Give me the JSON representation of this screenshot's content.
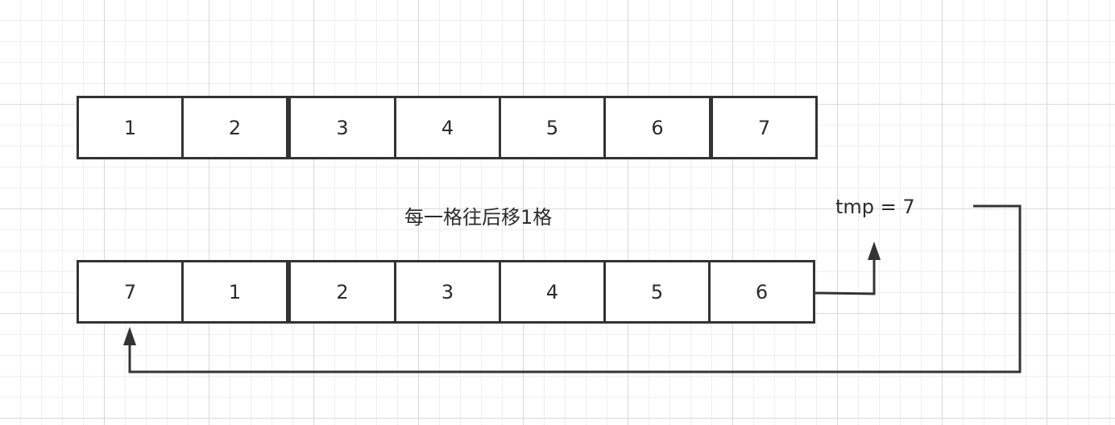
{
  "diagram": {
    "top_row": [
      "1",
      "2",
      "3",
      "4",
      "5",
      "6",
      "7"
    ],
    "bottom_row": [
      "7",
      "1",
      "2",
      "3",
      "4",
      "5",
      "6"
    ],
    "caption": "每一格往后移1格",
    "tmp_label": "tmp = 7"
  },
  "colors": {
    "stroke": "#333333",
    "grid_minor": "#efefef",
    "grid_major": "#d9d9d9"
  }
}
